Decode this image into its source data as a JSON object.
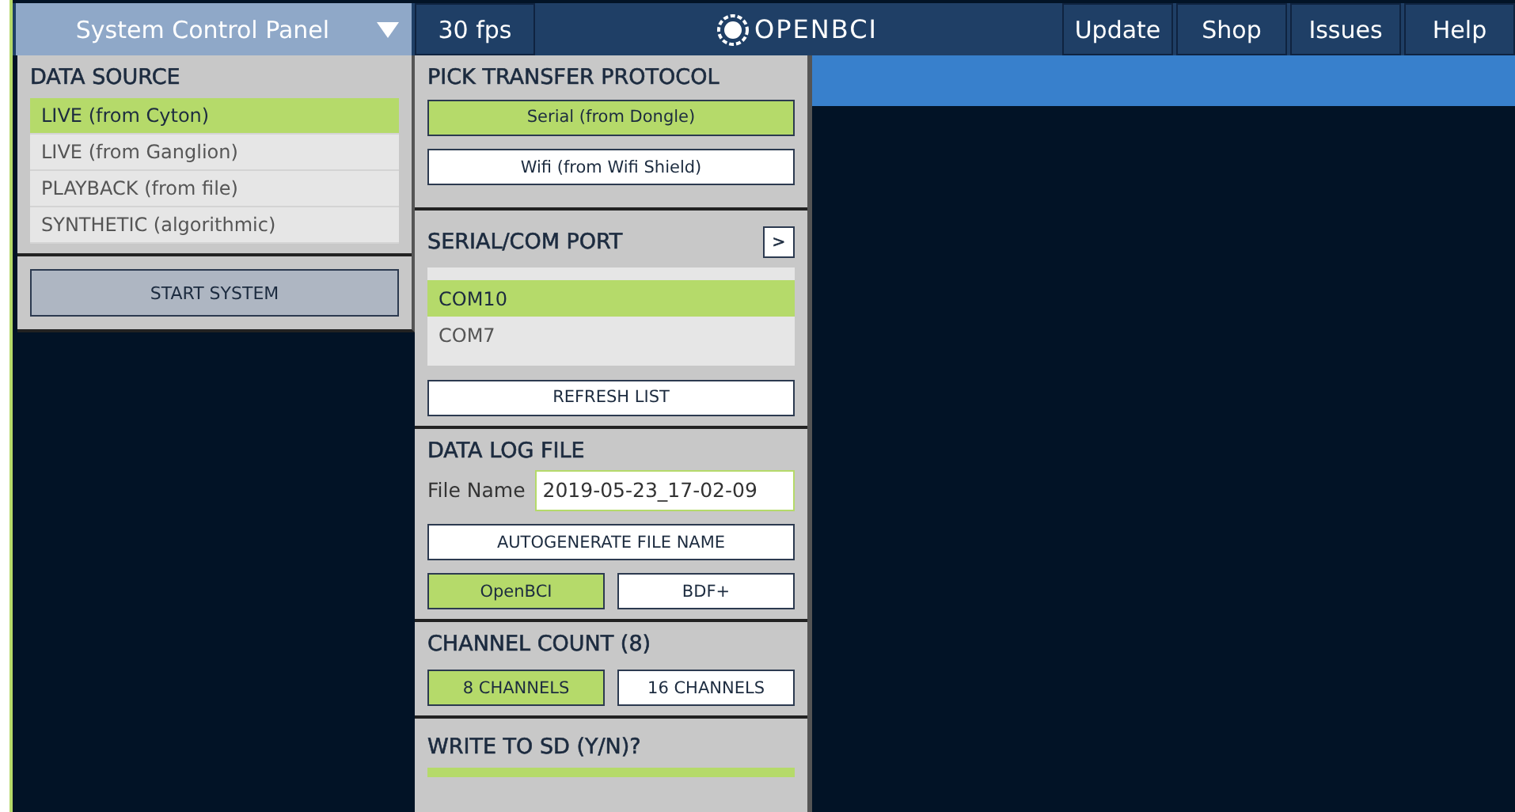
{
  "top_bar": {
    "panel_title": "System Control Panel",
    "panel_expanded": true,
    "fps": "30 fps",
    "logo": "OPENBCI",
    "buttons": [
      "Update",
      "Shop",
      "Issues",
      "Help"
    ]
  },
  "data_source": {
    "title": "DATA SOURCE",
    "items": [
      {
        "label": "LIVE (from Cyton)",
        "selected": true
      },
      {
        "label": "LIVE (from Ganglion)",
        "selected": false
      },
      {
        "label": "PLAYBACK (from file)",
        "selected": false
      },
      {
        "label": "SYNTHETIC (algorithmic)",
        "selected": false
      }
    ],
    "start_button": "START SYSTEM"
  },
  "transfer_protocol": {
    "title": "PICK TRANSFER PROTOCOL",
    "options": [
      {
        "label": "Serial (from Dongle)",
        "selected": true
      },
      {
        "label": "Wifi (from Wifi Shield)",
        "selected": false
      }
    ]
  },
  "serial_port": {
    "title": "SERIAL/COM PORT",
    "toggle": ">",
    "ports": [
      {
        "label": "COM10",
        "selected": true
      },
      {
        "label": "COM7",
        "selected": false
      }
    ],
    "refresh_button": "REFRESH LIST"
  },
  "data_log": {
    "title": "DATA LOG FILE",
    "file_name_label": "File Name",
    "file_name": "2019-05-23_17-02-09",
    "autogenerate_button": "AUTOGENERATE FILE NAME",
    "formats": [
      {
        "label": "OpenBCI",
        "selected": true
      },
      {
        "label": "BDF+",
        "selected": false
      }
    ]
  },
  "channel_count": {
    "title": "CHANNEL COUNT (8)",
    "options": [
      {
        "label": "8 CHANNELS",
        "selected": true
      },
      {
        "label": "16 CHANNELS",
        "selected": false
      }
    ]
  },
  "write_to_sd": {
    "title": "WRITE TO SD (Y/N)?",
    "options": [
      {
        "selected": true
      }
    ]
  }
}
